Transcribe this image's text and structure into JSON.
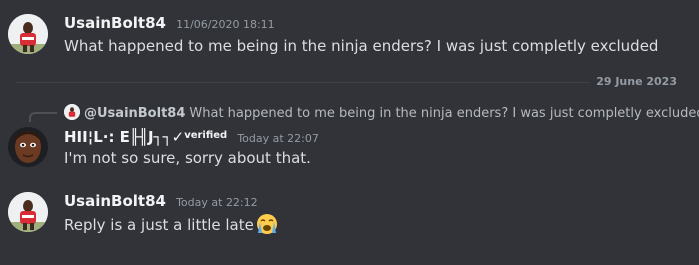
{
  "messages": [
    {
      "author": "UsainBolt84",
      "timestamp": "11/06/2020 18:11",
      "content": "What happened to me being in the ninja enders? I was just completly excluded"
    },
    {
      "reply": {
        "mention": "@UsainBolt84",
        "text": "What happened to me being in the ninja enders? I was just completly excluded"
      },
      "author": "HII¦L·: E╟╢J┐┐✓",
      "author_suffix": "verified",
      "timestamp": "Today at 22:07",
      "content": "I'm not so sure, sorry about that."
    },
    {
      "author": "UsainBolt84",
      "timestamp": "Today at 22:12",
      "content": "Reply is a just a little late",
      "emoji": "loudly-crying-face-emoji"
    }
  ],
  "divider": {
    "date": "29 June 2023"
  },
  "colors": {
    "background": "#313338",
    "text": "#dbdee1",
    "author": "#f2f3f5",
    "muted": "#949ba4"
  }
}
